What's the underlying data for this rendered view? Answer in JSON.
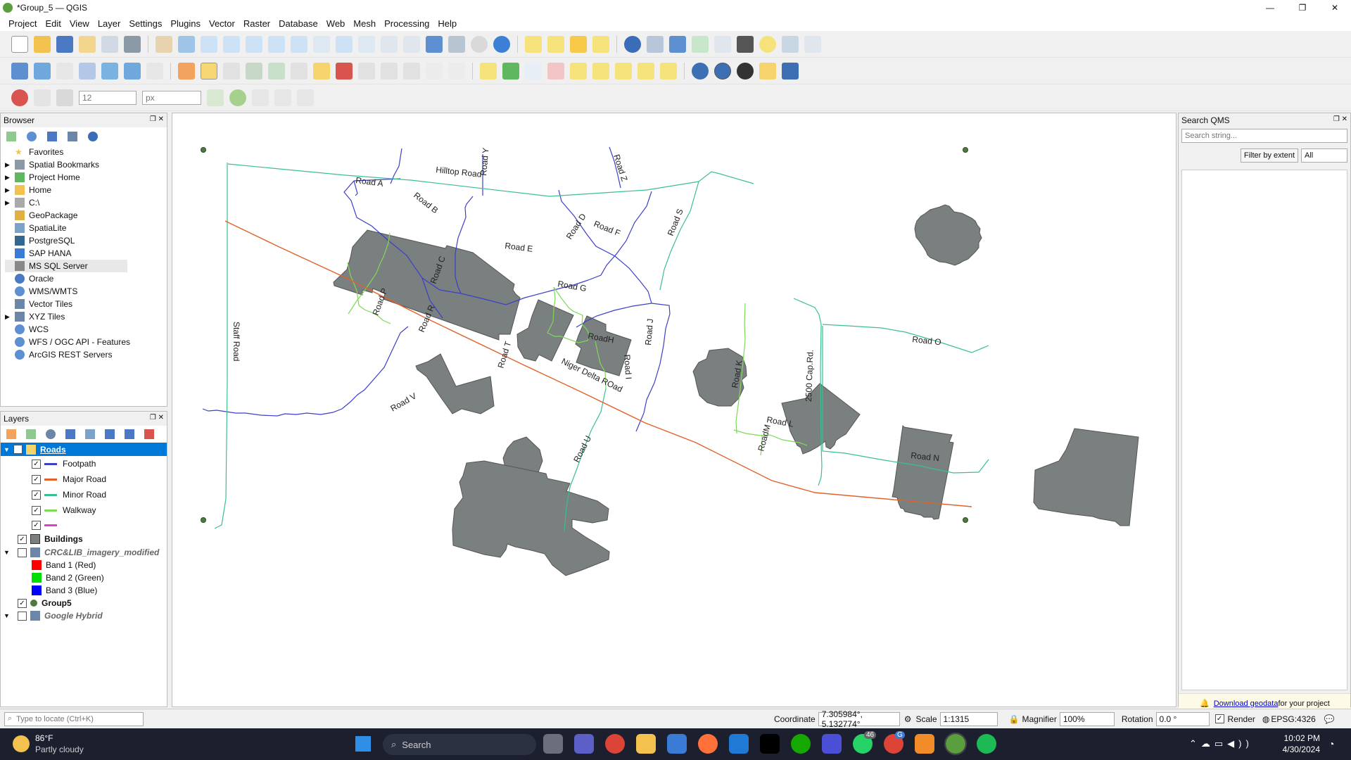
{
  "window": {
    "title": "*Group_5 — QGIS",
    "minimize": "—",
    "maximize": "❐",
    "close": "✕"
  },
  "menu": [
    "Project",
    "Edit",
    "View",
    "Layer",
    "Settings",
    "Plugins",
    "Vector",
    "Raster",
    "Database",
    "Web",
    "Mesh",
    "Processing",
    "Help"
  ],
  "digitize": {
    "size_value": "12",
    "unit": "px"
  },
  "browser": {
    "title": "Browser",
    "items": [
      "Favorites",
      "Spatial Bookmarks",
      "Project Home",
      "Home",
      "C:\\",
      "GeoPackage",
      "SpatiaLite",
      "PostgreSQL",
      "SAP HANA",
      "MS SQL Server",
      "Oracle",
      "WMS/WMTS",
      "Vector Tiles",
      "XYZ Tiles",
      "WCS",
      "WFS / OGC API - Features",
      "ArcGIS REST Servers"
    ]
  },
  "layers": {
    "title": "Layers",
    "roads": "Roads",
    "road_classes": [
      {
        "label": "Footpath",
        "color": "#3c3fc9"
      },
      {
        "label": "Major Road",
        "color": "#e0622a"
      },
      {
        "label": "Minor Road",
        "color": "#3cbf8e"
      },
      {
        "label": "Walkway",
        "color": "#7ed957"
      },
      {
        "label": "",
        "color": "#e040c8"
      }
    ],
    "buildings": "Buildings",
    "imagery": "CRC&LIB_imagery_modified",
    "bands": [
      {
        "label": "Band 1 (Red)",
        "color": "#ff0000"
      },
      {
        "label": "Band 2 (Green)",
        "color": "#00dd00"
      },
      {
        "label": "Band 3 (Blue)",
        "color": "#0000ff"
      }
    ],
    "group5": "Group5",
    "google": "Google Hybrid"
  },
  "map": {
    "labels": [
      "Hilltop Road",
      "Road A",
      "Road B",
      "Road C",
      "Road D",
      "Road E",
      "Road F",
      "Road G",
      "RoadH",
      "Road I",
      "Road J",
      "Road K",
      "Road L",
      "RoadM",
      "Road N",
      "Road O",
      "Road P",
      "Road R",
      "Road S",
      "Road T",
      "Road U",
      "Road V",
      "Road Y",
      "Road Z",
      "Niger Delta ROad",
      "Staff Road",
      "2500 Cap.Rd."
    ]
  },
  "qms": {
    "title": "Search QMS",
    "placeholder": "Search string...",
    "filter_btn": "Filter by extent",
    "filter_value": "All",
    "notice_link": "Download geodata",
    "notice_rest": " for your project"
  },
  "status": {
    "locate_placeholder": "Type to locate (Ctrl+K)",
    "coordinate_label": "Coordinate",
    "coordinate": "7.305984°, 5.132774°",
    "scale_label": "Scale",
    "scale": "1:1315",
    "magnifier_label": "Magnifier",
    "magnifier": "100%",
    "rotation_label": "Rotation",
    "rotation": "0.0 °",
    "render": "Render",
    "crs": "EPSG:4326"
  },
  "taskbar": {
    "temp": "86°F",
    "weather": "Partly cloudy",
    "search": "Search",
    "time": "10:02 PM",
    "date": "4/30/2024",
    "badge1": "46",
    "badge2": "G"
  }
}
